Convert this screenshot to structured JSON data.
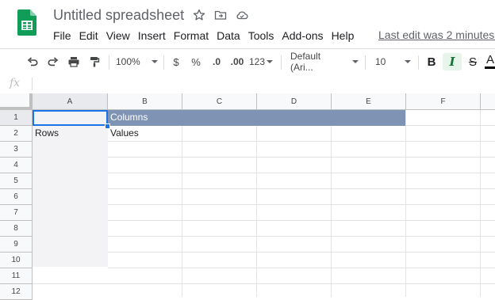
{
  "app": {
    "title": "Untitled spreadsheet",
    "menu": [
      "File",
      "Edit",
      "View",
      "Insert",
      "Format",
      "Data",
      "Tools",
      "Add-ons",
      "Help"
    ],
    "last_edit": "Last edit was 2 minutes ago",
    "icons": [
      "sheets-logo-icon",
      "star-icon",
      "move-to-folder-icon",
      "cloud-saved-icon"
    ]
  },
  "toolbar": {
    "zoom": "100%",
    "currency": "$",
    "percent": "%",
    "decrease_decimal": ".0",
    "increase_decimal": ".00",
    "more_formats": "123",
    "font": "Default (Ari...",
    "font_size": "10",
    "bold": "B",
    "italic": "I",
    "strikethrough": "S",
    "text_color": "A",
    "icons": [
      "undo-icon",
      "redo-icon",
      "print-icon",
      "paint-format-icon"
    ]
  },
  "formula_bar": {
    "fx": "fx",
    "value": ""
  },
  "grid": {
    "columns": [
      "A",
      "B",
      "C",
      "D",
      "E",
      "F"
    ],
    "rows": [
      "1",
      "2",
      "3",
      "4",
      "5",
      "6",
      "7",
      "8",
      "9",
      "10",
      "11",
      "12"
    ],
    "cells": {
      "B1": "Columns",
      "A2": "Rows",
      "B2": "Values"
    },
    "selected": "A1",
    "colors": {
      "header_fill": "#7f93b5",
      "header_text": "#ffffff",
      "row_label_fill": "#f3f3f5",
      "selection": "#1a73e8"
    }
  }
}
